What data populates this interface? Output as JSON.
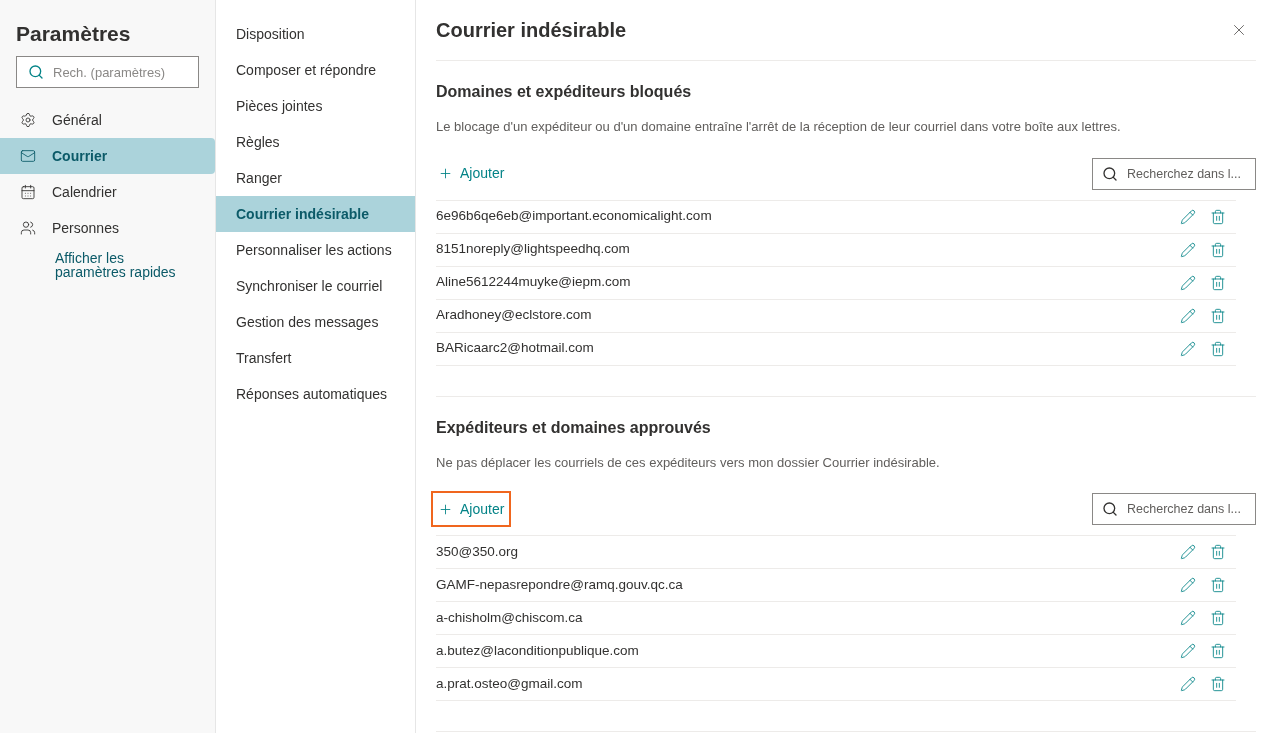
{
  "sidebar": {
    "title": "Paramètres",
    "search": {
      "placeholder": "Rech. (paramètres)"
    },
    "items": [
      {
        "kind": "gear",
        "label": "Général",
        "selected": false
      },
      {
        "kind": "mail",
        "label": "Courrier",
        "selected": true
      },
      {
        "kind": "calendar",
        "label": "Calendrier",
        "selected": false
      },
      {
        "kind": "people",
        "label": "Personnes",
        "selected": false
      }
    ],
    "quick_link": "Afficher les paramètres rapides"
  },
  "subnav": {
    "items": [
      {
        "label": "Disposition",
        "selected": false
      },
      {
        "label": "Composer et répondre",
        "selected": false
      },
      {
        "label": "Pièces jointes",
        "selected": false
      },
      {
        "label": "Règles",
        "selected": false
      },
      {
        "label": "Ranger",
        "selected": false
      },
      {
        "label": "Courrier indésirable",
        "selected": true
      },
      {
        "label": "Personnaliser les actions",
        "selected": false
      },
      {
        "label": "Synchroniser le courriel",
        "selected": false
      },
      {
        "label": "Gestion des messages",
        "selected": false
      },
      {
        "label": "Transfert",
        "selected": false
      },
      {
        "label": "Réponses automatiques",
        "selected": false
      }
    ]
  },
  "panel": {
    "title": "Courrier indésirable",
    "sections": [
      {
        "heading": "Domaines et expéditeurs bloqués",
        "description": "Le blocage d'un expéditeur ou d'un domaine entraîne l'arrêt de la réception de leur courriel dans votre boîte aux lettres.",
        "add_label": "Ajouter",
        "add_highlighted": false,
        "search_placeholder": "Recherchez dans l...",
        "entries": [
          "6e96b6qe6eb@important.economicalight.com",
          "8151noreply@lightspeedhq.com",
          "Aline5612244muyke@iepm.com",
          "Aradhoney@eclstore.com",
          "BARicaarc2@hotmail.com"
        ]
      },
      {
        "heading": "Expéditeurs et domaines approuvés",
        "description": "Ne pas déplacer les courriels de ces expéditeurs vers mon dossier Courrier indésirable.",
        "add_label": "Ajouter",
        "add_highlighted": true,
        "search_placeholder": "Recherchez dans l...",
        "entries": [
          "350@350.org",
          "GAMF-nepasrepondre@ramq.gouv.qc.ca",
          "a-chisholm@chiscom.ca",
          "a.butez@laconditionpublique.com",
          "a.prat.osteo@gmail.com"
        ]
      }
    ]
  }
}
